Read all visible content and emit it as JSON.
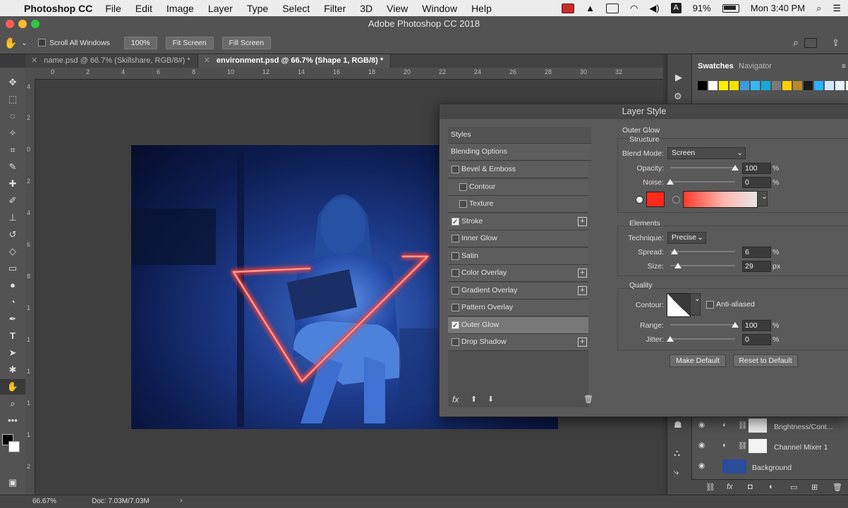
{
  "menubar": {
    "app_name": "Photoshop CC",
    "items": [
      "File",
      "Edit",
      "Image",
      "Layer",
      "Type",
      "Select",
      "Filter",
      "3D",
      "View",
      "Window",
      "Help"
    ],
    "battery": "91%",
    "clock": "Mon 3:40 PM",
    "input_source": "A"
  },
  "window": {
    "title": "Adobe Photoshop CC 2018"
  },
  "options_bar": {
    "scroll_all_windows": "Scroll All Windows",
    "zoom": "100%",
    "fit_screen": "Fit Screen",
    "fill_screen": "Fill Screen"
  },
  "tabs": [
    {
      "label": "name.psd @ 66.7% (Skillshare, RGB/8#) *",
      "active": false
    },
    {
      "label": "environment.psd @ 66.7% (Shape 1, RGB/8) *",
      "active": true
    }
  ],
  "ruler": {
    "top": [
      "0",
      "2",
      "4",
      "6",
      "8",
      "10",
      "12",
      "14",
      "16",
      "18",
      "20",
      "22",
      "24",
      "26",
      "28",
      "30",
      "32"
    ],
    "left": [
      "4",
      "2",
      "0",
      "2",
      "4",
      "6",
      "8",
      "1",
      "1",
      "1",
      "1",
      "1",
      "2"
    ]
  },
  "right_panel": {
    "tabs": [
      "Swatches",
      "Navigator"
    ],
    "swatches": [
      "#000000",
      "#ffffff",
      "#ffee00",
      "#f5e100",
      "#3d9ae0",
      "#36b7f0",
      "#18a8d8",
      "#7a7a7a",
      "#ffd100",
      "#b88a2a",
      "#1c1c1c",
      "#2ab2ff",
      "#cfe8ff",
      "#e8f3ff",
      "#ffffff"
    ],
    "layers": [
      {
        "name": "Brightness/Cont...",
        "type": "adjustment"
      },
      {
        "name": "Channel Mixer 1",
        "type": "adjustment"
      },
      {
        "name": "Background",
        "type": "image"
      }
    ]
  },
  "dialog": {
    "title": "Layer Style",
    "styles_header": "Styles",
    "blending_options": "Blending Options",
    "items": [
      {
        "label": "Bevel & Emboss",
        "checked": false,
        "plus": false,
        "indent": false
      },
      {
        "label": "Contour",
        "checked": false,
        "plus": false,
        "indent": true
      },
      {
        "label": "Texture",
        "checked": false,
        "plus": false,
        "indent": true
      },
      {
        "label": "Stroke",
        "checked": true,
        "plus": true,
        "indent": false
      },
      {
        "label": "Inner Glow",
        "checked": false,
        "plus": false,
        "indent": false
      },
      {
        "label": "Satin",
        "checked": false,
        "plus": false,
        "indent": false
      },
      {
        "label": "Color Overlay",
        "checked": false,
        "plus": true,
        "indent": false
      },
      {
        "label": "Gradient Overlay",
        "checked": false,
        "plus": true,
        "indent": false
      },
      {
        "label": "Pattern Overlay",
        "checked": false,
        "plus": false,
        "indent": false
      },
      {
        "label": "Outer Glow",
        "checked": true,
        "plus": false,
        "indent": false,
        "selected": true
      },
      {
        "label": "Drop Shadow",
        "checked": false,
        "plus": true,
        "indent": false
      }
    ],
    "fx_label": "fx",
    "outer_glow": {
      "title": "Outer Glow",
      "structure": "Structure",
      "blend_mode_label": "Blend Mode:",
      "blend_mode": "Screen",
      "opacity_label": "Opacity:",
      "opacity": "100",
      "noise_label": "Noise:",
      "noise": "0",
      "glow_color": "#ff2a1a",
      "percent": "%",
      "elements": "Elements",
      "technique_label": "Technique:",
      "technique": "Precise",
      "spread_label": "Spread:",
      "spread": "6",
      "size_label": "Size:",
      "size": "29",
      "px": "px",
      "quality": "Quality",
      "contour_label": "Contour:",
      "anti_aliased": "Anti-aliased",
      "range_label": "Range:",
      "range": "100",
      "jitter_label": "Jitter:",
      "jitter": "0",
      "make_default": "Make Default",
      "reset_default": "Reset to Default"
    },
    "values": {
      "opacity": 100,
      "noise": 0,
      "spread": 6,
      "size": 29,
      "range": 100,
      "jitter": 0
    }
  },
  "status": {
    "zoom": "66.67%",
    "doc": "Doc: 7.03M/7.03M"
  }
}
